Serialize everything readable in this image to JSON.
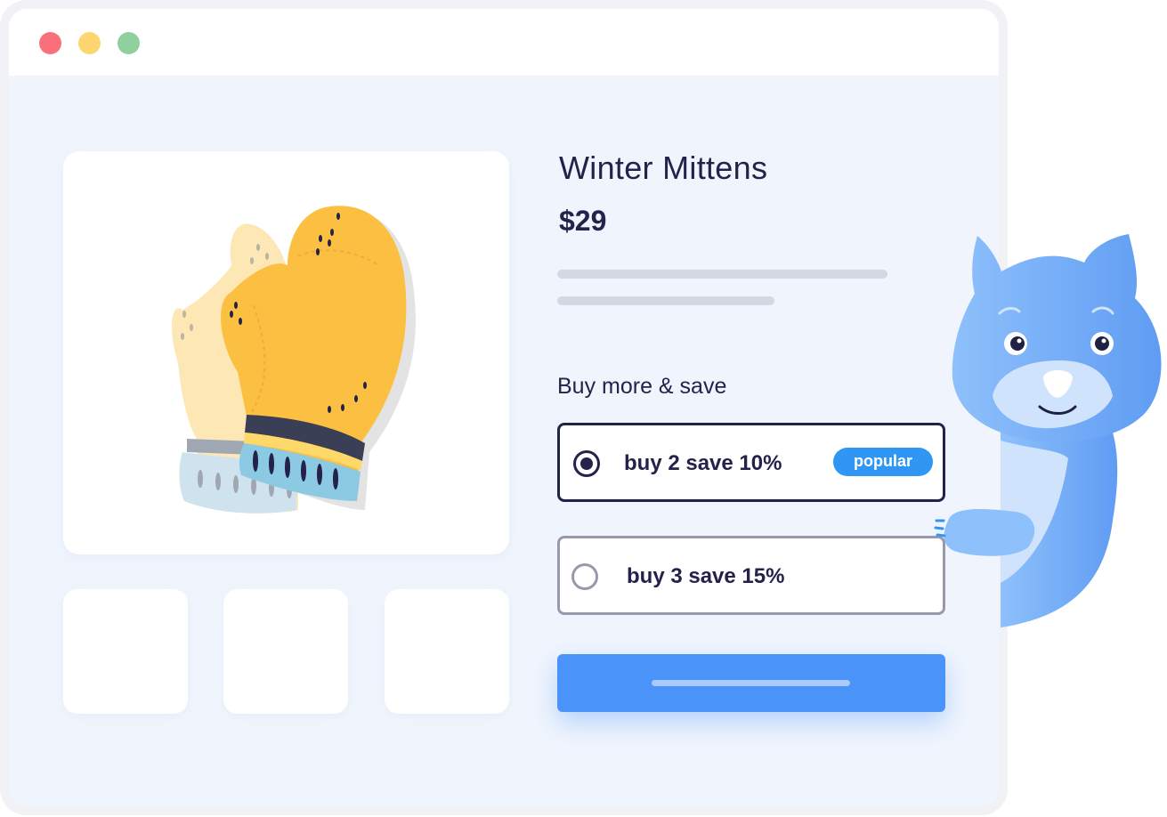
{
  "window": {
    "controls": [
      "close",
      "minimize",
      "maximize"
    ]
  },
  "product": {
    "title": "Winter Mittens",
    "price": "$29",
    "image_icon": "mittens-illustration",
    "thumbnails": 3
  },
  "offer": {
    "heading": "Buy more & save",
    "options": [
      {
        "label": "buy 2 save 10%",
        "selected": true,
        "badge": "popular"
      },
      {
        "label": "buy 3 save 15%",
        "selected": false
      }
    ]
  },
  "colors": {
    "accent": "#4a93f9",
    "badge": "#2f96f3",
    "text": "#24224a",
    "background": "#f0f5fd"
  },
  "mascot": "blue-cat-mascot"
}
